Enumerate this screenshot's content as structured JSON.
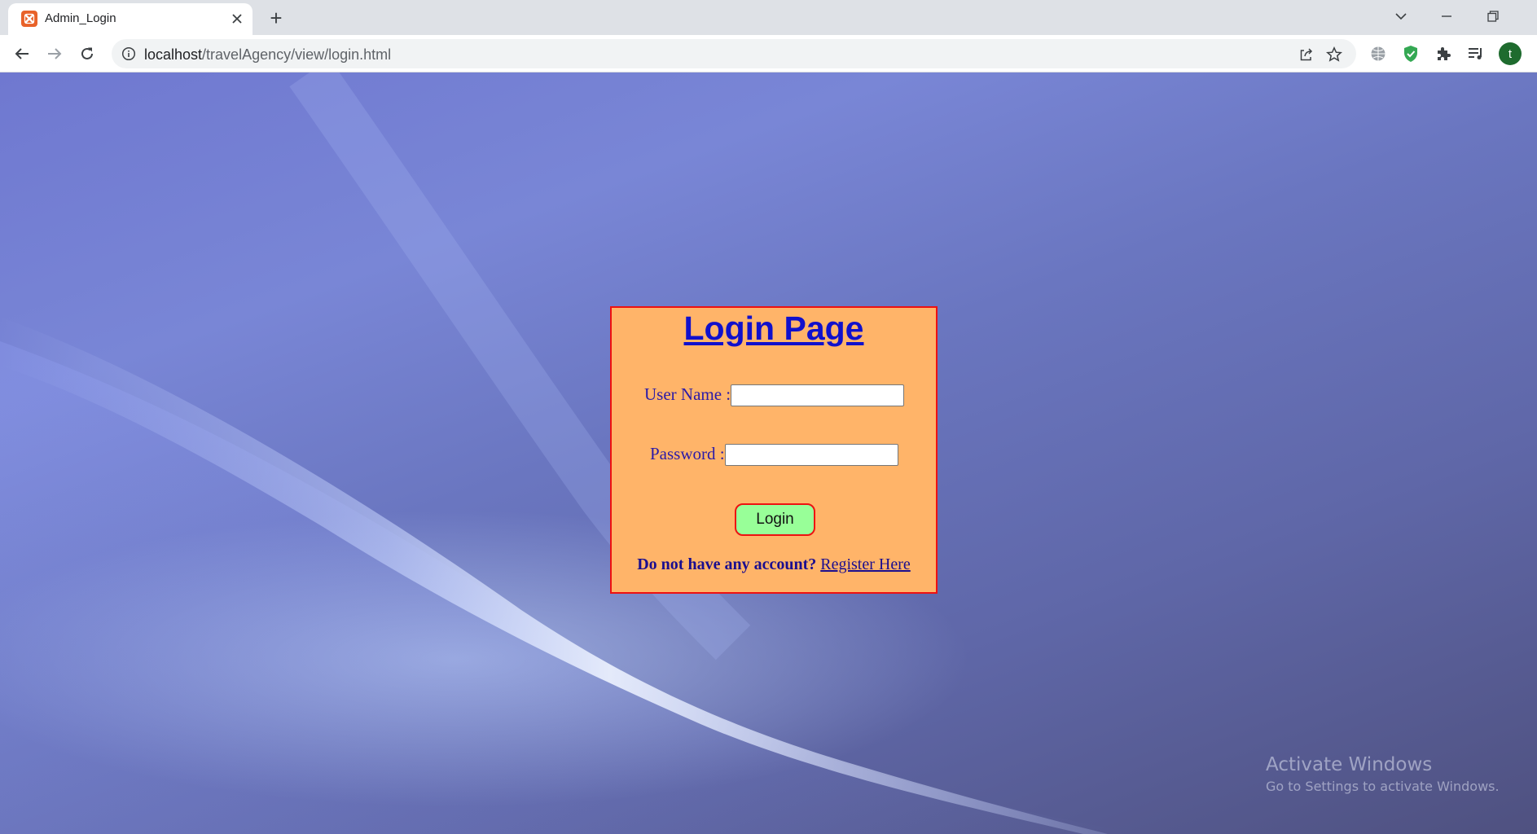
{
  "browser": {
    "tab_title": "Admin_Login",
    "new_tab_symbol": "+",
    "url_host": "localhost",
    "url_path": "/travelAgency/view/login.html",
    "profile_initial": "t"
  },
  "login": {
    "title": "Login Page",
    "username_label": "User Name :",
    "username_value": "",
    "password_label": "Password :",
    "password_value": "",
    "login_button": "Login",
    "no_account_text": "Do not have any account?",
    "register_link": "Register Here"
  },
  "watermark": {
    "title": "Activate Windows",
    "subtitle": "Go to Settings to activate Windows."
  },
  "colors": {
    "box_background": "#ffb469",
    "box_border": "#ee1111",
    "title_color": "#1010cc",
    "button_background": "#98ff98"
  },
  "icons": [
    "xampp-favicon-icon",
    "close-icon",
    "plus-icon",
    "chevron-down-icon",
    "minimize-icon",
    "restore-icon",
    "back-arrow-icon",
    "forward-arrow-icon",
    "reload-icon",
    "info-icon",
    "share-icon",
    "star-icon",
    "globe-icon",
    "shield-check-icon",
    "puzzle-icon",
    "media-queue-icon"
  ]
}
